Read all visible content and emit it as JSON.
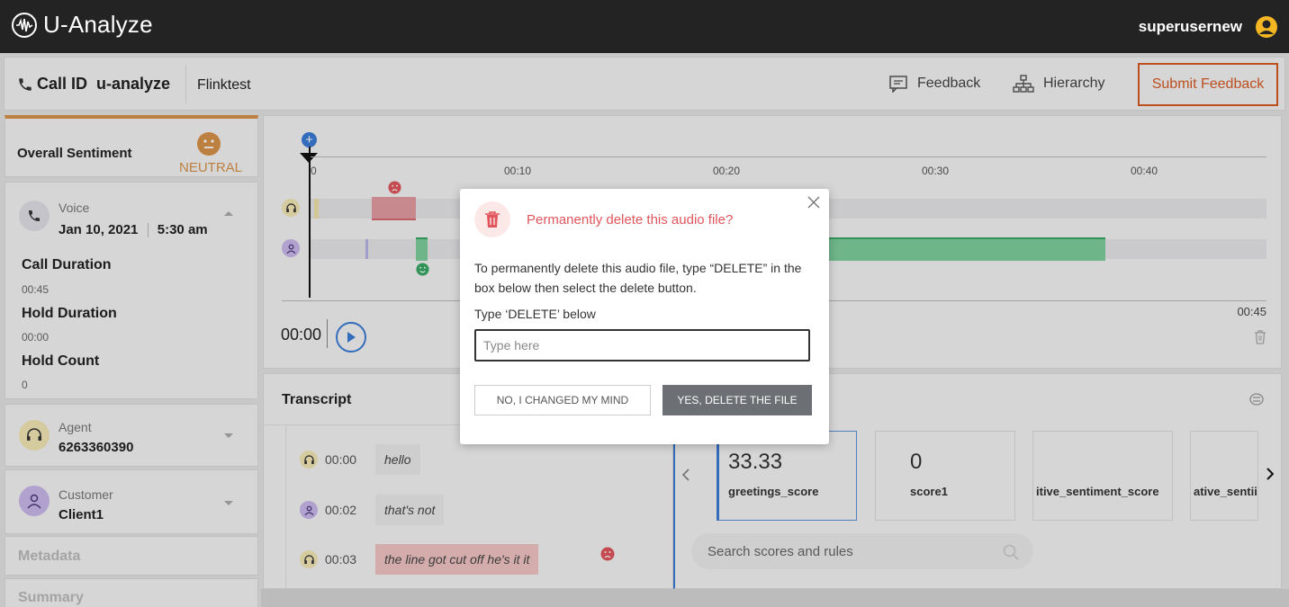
{
  "app": {
    "name": "U-Analyze",
    "username": "superusernew"
  },
  "call": {
    "call_id_label": "Call ID",
    "call_id_value": "u-analyze",
    "call_name": "Flinktest",
    "feedback_label": "Feedback",
    "hierarchy_label": "Hierarchy",
    "submit_label": "Submit Feedback"
  },
  "sidebar": {
    "sentiment_label": "Overall Sentiment",
    "sentiment_value": "NEUTRAL",
    "channel_label": "Voice",
    "date": "Jan 10, 2021",
    "time": "5:30 am",
    "call_duration_label": "Call Duration",
    "call_duration": "00:45",
    "hold_duration_label": "Hold Duration",
    "hold_duration": "00:00",
    "hold_count_label": "Hold Count",
    "hold_count": "0",
    "agent_label": "Agent",
    "agent_value": "6263360390",
    "customer_label": "Customer",
    "customer_value": "Client1",
    "metadata_label": "Metadata",
    "summary_label": "Summary"
  },
  "timeline": {
    "ticks": [
      "0",
      "00:10",
      "00:20",
      "00:30",
      "00:40"
    ],
    "end_time": "00:45",
    "current_time": "00:00"
  },
  "transcript": {
    "title": "Transcript",
    "rows": [
      {
        "time": "00:00",
        "text": "hello",
        "speaker": "agent"
      },
      {
        "time": "00:02",
        "text": "that's not",
        "speaker": "customer"
      },
      {
        "time": "00:03",
        "text": "the line got cut off he's it it",
        "speaker": "agent"
      }
    ]
  },
  "scores": {
    "cards": [
      {
        "value": "33.33",
        "name": "greetings_score"
      },
      {
        "value": "0",
        "name": "score1"
      },
      {
        "value": "",
        "name": "itive_sentiment_score"
      },
      {
        "value": "",
        "name": "ative_sentii"
      }
    ],
    "search_placeholder": "Search scores and rules"
  },
  "dialog": {
    "title": "Permanently delete this audio file?",
    "body": "To permanently delete this audio file, type “DELETE” in the box below then select the delete button.",
    "input_label": "Type ‘DELETE’ below",
    "input_placeholder": "Type here",
    "cancel_label": "NO, I CHANGED MY MIND",
    "confirm_label": "YES, DELETE THE FILE"
  },
  "colors": {
    "accent_blue": "#3a7bd5",
    "submit_orange": "#d65a24",
    "neutral_amber": "#d8924a",
    "danger_red": "#e0565c",
    "positive_green": "#5cbf84"
  }
}
